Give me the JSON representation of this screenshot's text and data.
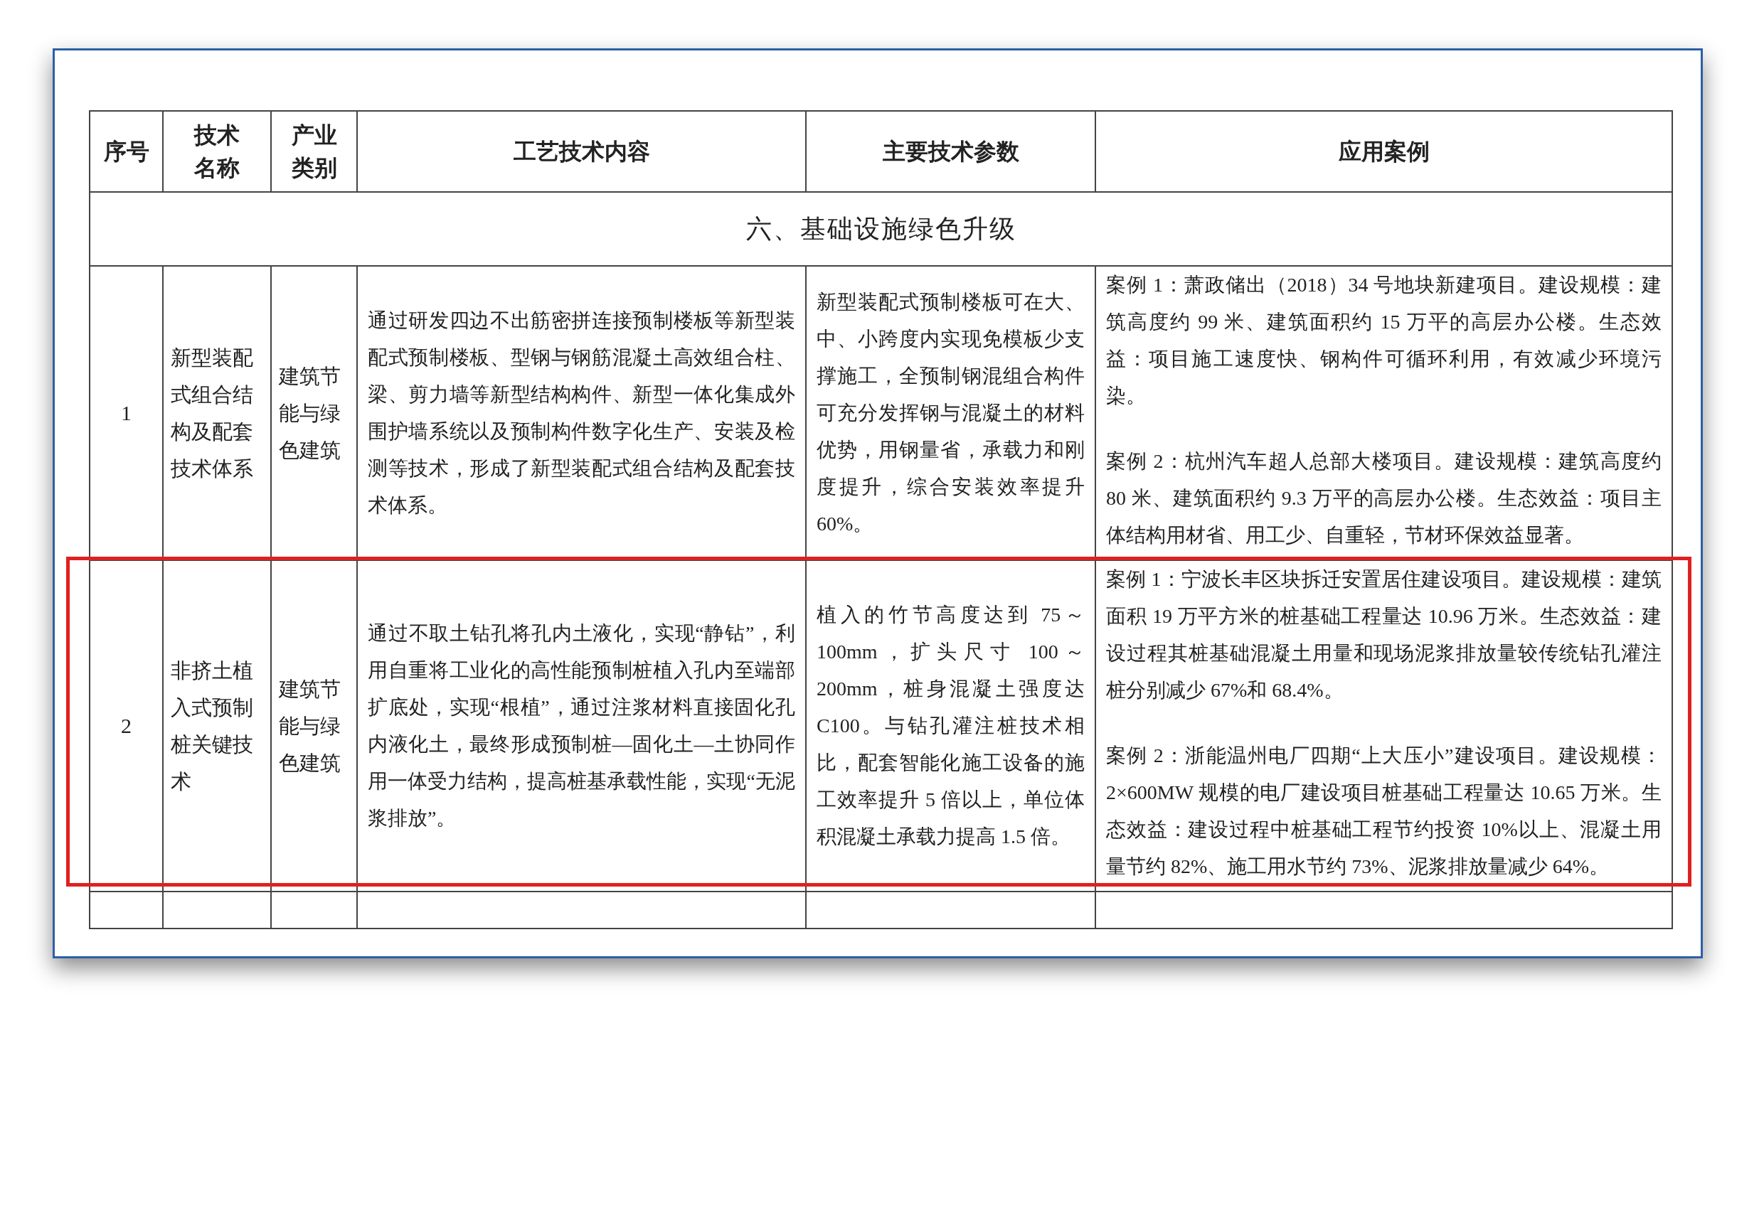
{
  "table": {
    "columns": [
      "序号",
      "技术名称",
      "产业类别",
      "工艺技术内容",
      "主要技术参数",
      "应用案例"
    ],
    "rows": [
      {
        "kind": "section",
        "title": "六、基础设施绿色升级"
      },
      {
        "kind": "item",
        "highlighted": false,
        "number": "1",
        "name": "新型装配式组合结构及配套技术体系",
        "industry": "建筑节能与绿色建筑",
        "content": "通过研发四边不出筋密拼连接预制楼板等新型装配式预制楼板、型钢与钢筋混凝土高效组合柱、梁、剪力墙等新型结构构件、新型一体化集成外围护墙系统以及预制构件数字化生产、安装及检测等技术，形成了新型装配式组合结构及配套技术体系。",
        "parameters": "新型装配式预制楼板可在大、中、小跨度内实现免模板少支撑施工，全预制钢混组合构件可充分发挥钢与混凝土的材料优势，用钢量省，承载力和刚度提升，综合安装效率提升60%。",
        "cases": [
          "案例 1：萧政储出（2018）34 号地块新建项目。建设规模：建筑高度约 99 米、建筑面积约 15 万平的高层办公楼。生态效益：项目施工速度快、钢构件可循环利用，有效减少环境污染。",
          "案例 2：杭州汽车超人总部大楼项目。建设规模：建筑高度约 80 米、建筑面积约 9.3 万平的高层办公楼。生态效益：项目主体结构用材省、用工少、自重轻，节材环保效益显著。"
        ]
      },
      {
        "kind": "item",
        "highlighted": true,
        "number": "2",
        "name": "非挤土植入式预制桩关键技术",
        "industry": "建筑节能与绿色建筑",
        "content": "通过不取土钻孔将孔内土液化，实现“静钻”，利用自重将工业化的高性能预制桩植入孔内至端部扩底处，实现“根植”，通过注浆材料直接固化孔内液化土，最终形成预制桩—固化土—土协同作用一体受力结构，提高桩基承载性能，实现“无泥浆排放”。",
        "parameters": "植入的竹节高度达到 75～100mm，扩头尺寸 100～200mm，桩身混凝土强度达 C100。与钻孔灌注桩技术相比，配套智能化施工设备的施工效率提升 5 倍以上，单位体积混凝土承载力提高 1.5 倍。",
        "cases": [
          "案例 1：宁波长丰区块拆迁安置居住建设项目。建设规模：建筑面积 19 万平方米的桩基础工程量达 10.96 万米。生态效益：建设过程其桩基础混凝土用量和现场泥浆排放量较传统钻孔灌注桩分别减少 67%和 68.4%。",
          "案例 2：浙能温州电厂四期“上大压小”建设项目。建设规模：2×600MW 规模的电厂建设项目桩基础工程量达 10.65 万米。生态效益：建设过程中桩基础工程节约投资 10%以上、混凝土用量节约 82%、施工用水节约 73%、泥浆排放量减少 64%。"
        ]
      }
    ]
  }
}
